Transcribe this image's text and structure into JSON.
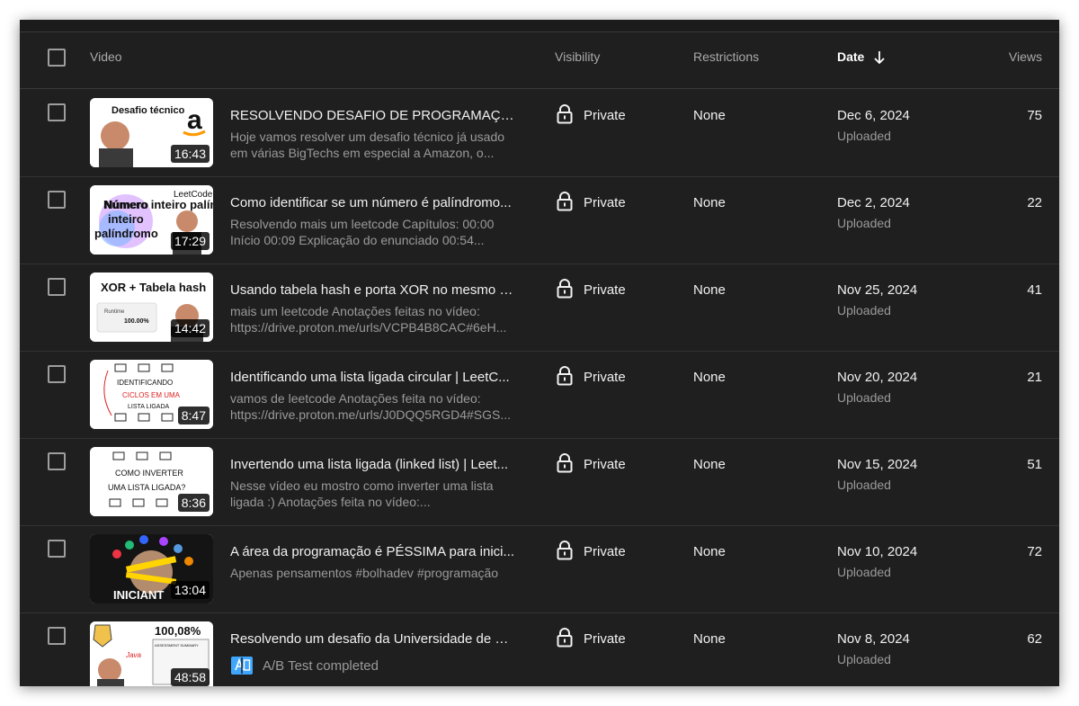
{
  "header": {
    "video_label": "Video",
    "visibility_label": "Visibility",
    "restrictions_label": "Restrictions",
    "date_label": "Date",
    "views_label": "Views"
  },
  "rows": [
    {
      "title": "RESOLVENDO DESAFIO DE PROGRAMAÇÃO ...",
      "description": "Hoje vamos resolver um desafio técnico já usado em várias BigTechs em especial a Amazon, o...",
      "duration": "16:43",
      "thumb_text": "Desafio técnico",
      "visibility": "Private",
      "restrictions": "None",
      "date": "Dec 6, 2024",
      "status": "Uploaded",
      "views": "75"
    },
    {
      "title": "Como identificar se um número é palíndromo...",
      "description": "Resolvendo mais um leetcode Capítulos: 00:00 Início 00:09 Explicação do enunciado 00:54...",
      "duration": "17:29",
      "thumb_text": "Número inteiro palíndromo",
      "thumb_text2": "LeetCode",
      "visibility": "Private",
      "restrictions": "None",
      "date": "Dec 2, 2024",
      "status": "Uploaded",
      "views": "22"
    },
    {
      "title": "Usando tabela hash e porta XOR no mesmo e...",
      "description": "mais um leetcode Anotações feitas no vídeo: https://drive.proton.me/urls/VCPB4B8CAC#6eH...",
      "duration": "14:42",
      "thumb_text": "XOR + Tabela hash",
      "thumb_text2": "Runtime",
      "thumb_text3": "100.00%",
      "visibility": "Private",
      "restrictions": "None",
      "date": "Nov 25, 2024",
      "status": "Uploaded",
      "views": "41"
    },
    {
      "title": "Identificando uma lista ligada circular | LeetC...",
      "description": "vamos de leetcode Anotações feita no vídeo: https://drive.proton.me/urls/J0DQQ5RGD4#SGS...",
      "duration": "8:47",
      "thumb_text": "IDENTIFICANDO",
      "thumb_text2": "CICLOS EM UMA",
      "thumb_text3": "LISTA LIGADA",
      "visibility": "Private",
      "restrictions": "None",
      "date": "Nov 20, 2024",
      "status": "Uploaded",
      "views": "21"
    },
    {
      "title": "Invertendo uma lista ligada (linked list) | Leet...",
      "description": "Nesse vídeo eu mostro como inverter uma lista ligada :) Anotações feita no vídeo:...",
      "duration": "8:36",
      "thumb_text": "COMO INVERTER",
      "thumb_text2": "UMA LISTA LIGADA?",
      "visibility": "Private",
      "restrictions": "None",
      "date": "Nov 15, 2024",
      "status": "Uploaded",
      "views": "51"
    },
    {
      "title": "A área da programação é PÉSSIMA para inici...",
      "description": "Apenas pensamentos #bolhadev #programação",
      "duration": "13:04",
      "thumb_text": "INICIANT",
      "visibility": "Private",
      "restrictions": "None",
      "date": "Nov 10, 2024",
      "status": "Uploaded",
      "views": "72"
    },
    {
      "title": "Resolvendo um desafio da Universidade de Pr...",
      "ab_test": "A/B Test completed",
      "duration": "48:58",
      "thumb_text": "100,08%",
      "thumb_text2": "Java",
      "thumb_text3": "ASSESSMENT SUMMARY",
      "visibility": "Private",
      "restrictions": "None",
      "date": "Nov 8, 2024",
      "status": "Uploaded",
      "views": "62"
    }
  ],
  "colors": {
    "background": "#1f1f1f",
    "text_primary": "#f1f1f1",
    "text_secondary": "#9a9a9a",
    "ab_icon": "#3ea6ff"
  }
}
